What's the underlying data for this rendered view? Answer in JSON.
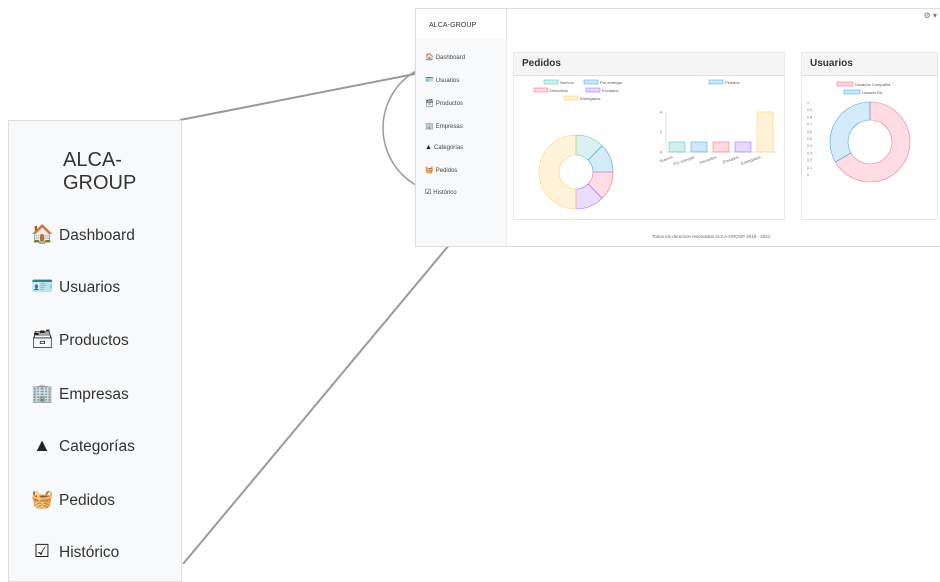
{
  "app": {
    "brand": "ALCA-GROUP"
  },
  "sidebar": {
    "items": [
      {
        "label": "Dashboard",
        "icon": "home-icon",
        "glyph": "🏠"
      },
      {
        "label": "Usuarios",
        "icon": "id-badge-icon",
        "glyph": "🪪"
      },
      {
        "label": "Productos",
        "icon": "archive-box-icon",
        "glyph": "🗃"
      },
      {
        "label": "Empresas",
        "icon": "building-icon",
        "glyph": "🏢"
      },
      {
        "label": "Categorías",
        "icon": "shapes-icon",
        "glyph": "▲"
      },
      {
        "label": "Pedidos",
        "icon": "basket-icon",
        "glyph": "🧺"
      },
      {
        "label": "Histórico",
        "icon": "checklist-icon",
        "glyph": "☑"
      }
    ]
  },
  "header": {
    "settings_glyph": "⚙ ▾"
  },
  "cards": {
    "pedidos": {
      "title": "Pedidos"
    },
    "usuarios": {
      "title": "Usuarios"
    }
  },
  "footer": {
    "text": "Todos los derechos reservados ALCA-GROUP 2018 - 2021"
  },
  "colors": {
    "teal": "#4bc0c0",
    "blue": "#36a2eb",
    "pink": "#ff6384",
    "purple": "#9966ff",
    "yellow": "#ffcd56"
  },
  "chart_data": [
    {
      "type": "pie",
      "legend": [
        "Nuevos",
        "Por entregar",
        "Devueltos",
        "Enviados",
        "Entregados"
      ],
      "values": [
        1,
        1,
        1,
        1,
        4
      ]
    },
    {
      "type": "bar",
      "legend": [
        "Pedidos"
      ],
      "categories": [
        "Nuevos",
        "Por entregar",
        "Devueltos",
        "Enviados",
        "Entregados"
      ],
      "values": [
        1,
        1,
        1,
        1,
        4
      ],
      "ylim": [
        0,
        4
      ]
    },
    {
      "type": "pie",
      "legend": [
        "Usuarios Compañía",
        "Usuario DA"
      ],
      "values": [
        2,
        1
      ],
      "ylim_labels": [
        "1",
        "0.9",
        "0.8",
        "0.7",
        "0.6",
        "0.5",
        "0.4",
        "0.3",
        "0.2",
        "0.1",
        "0"
      ]
    }
  ]
}
